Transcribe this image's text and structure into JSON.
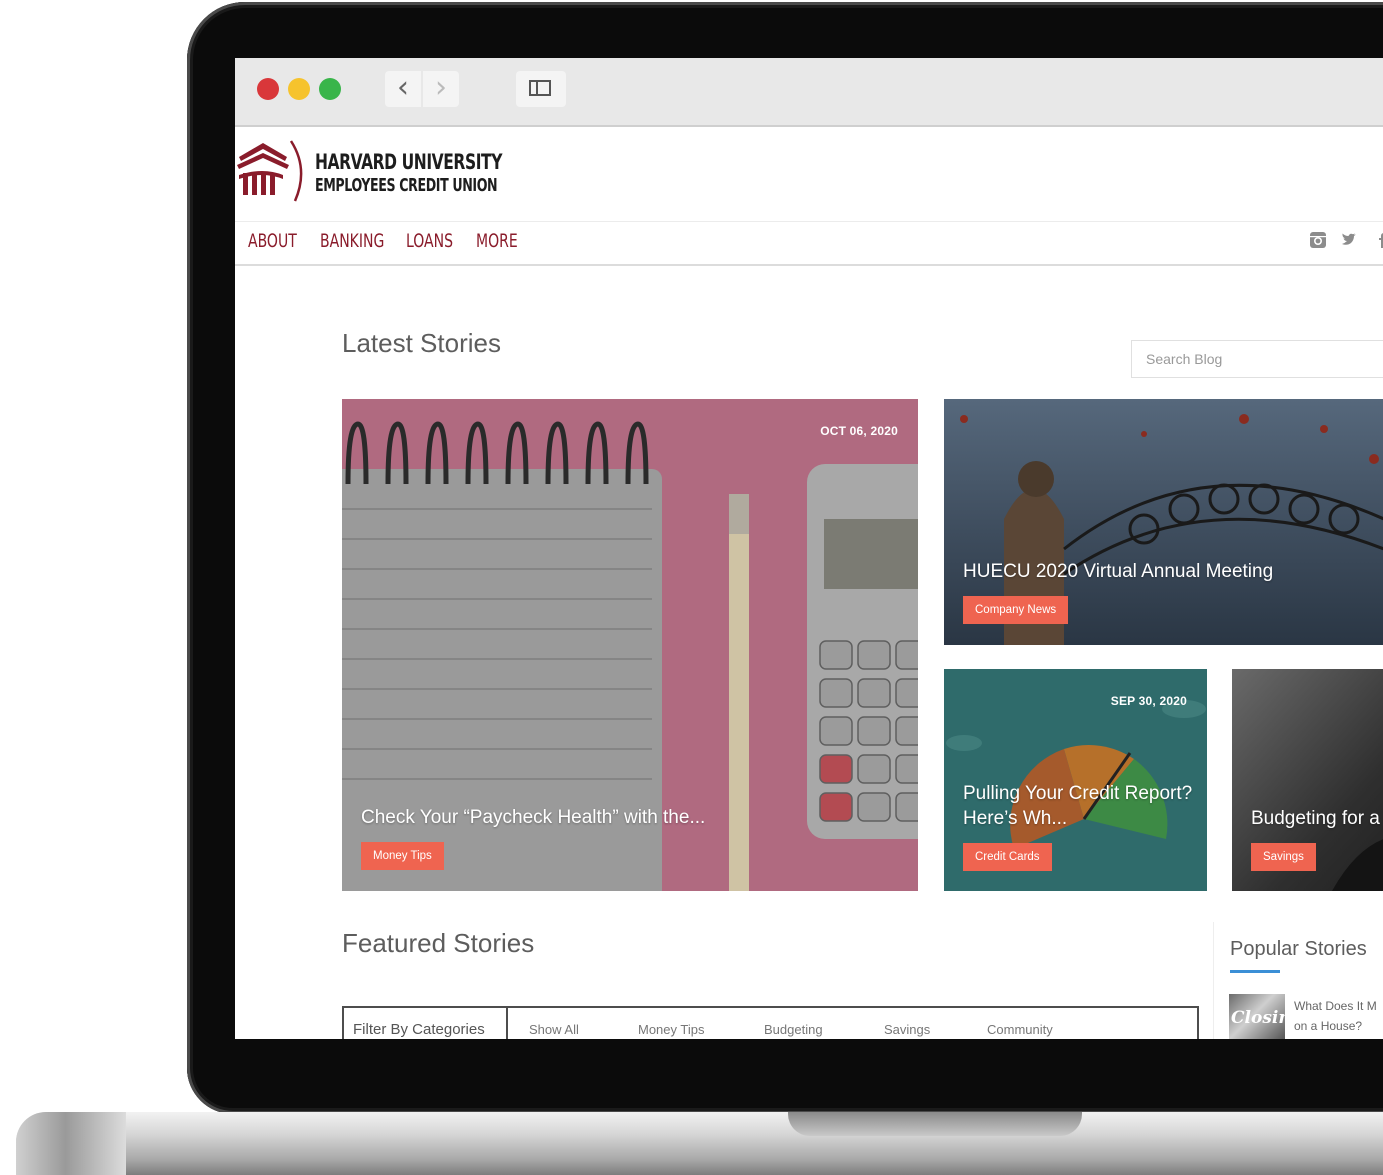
{
  "site": {
    "brand_line1": "HARVARD UNIVERSITY",
    "brand_line2": "EMPLOYEES CREDIT UNION",
    "brand_color": "#8a1c2b",
    "nav": [
      "ABOUT",
      "BANKING",
      "LOANS",
      "MORE"
    ],
    "social": [
      "instagram-icon",
      "twitter-icon",
      "facebook-icon"
    ]
  },
  "latest": {
    "title": "Latest Stories",
    "search_placeholder": "Search Blog",
    "cards": [
      {
        "date": "OCT 06, 2020",
        "title": "Check Your “Paycheck Health” with the...",
        "tag": "Money Tips"
      },
      {
        "date": "",
        "title": "HUECU 2020 Virtual Annual Meeting",
        "tag": "Company News"
      },
      {
        "date": "SEP 30, 2020",
        "title": "Pulling Your Credit Report? Here’s Wh...",
        "tag": "Credit Cards"
      },
      {
        "date": "",
        "title": "Budgeting for a",
        "tag": "Savings"
      }
    ],
    "tag_color": "#ef6450"
  },
  "featured": {
    "title": "Featured Stories",
    "filter_label": "Filter By Categories",
    "filters": [
      "Show All",
      "Money Tips",
      "Budgeting",
      "Savings",
      "Community"
    ]
  },
  "popular": {
    "title": "Popular Stories",
    "items": [
      {
        "thumb_text": "Closing",
        "line1": "What Does It M",
        "line2": "on a House?"
      }
    ]
  }
}
